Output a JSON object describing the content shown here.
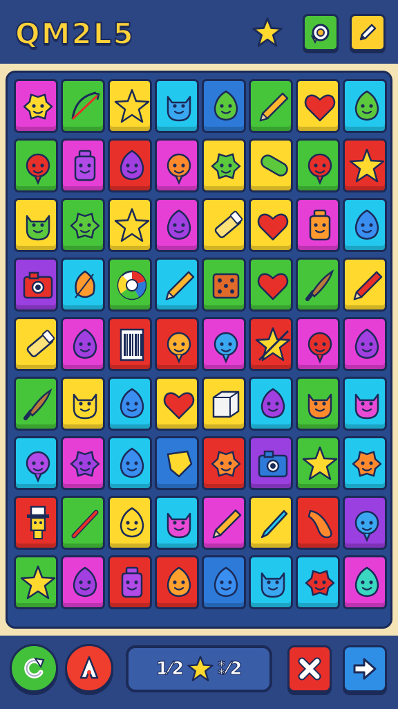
{
  "header": {
    "title": "QM2L5",
    "star_icon": "star-icon",
    "hint_button_icon": "target-icon",
    "edit_button_icon": "pencil-icon"
  },
  "board": {
    "rows": 9,
    "cols": 8,
    "colors": {
      "Y": "#ffd92e",
      "G": "#46c53a",
      "C": "#23c8ef",
      "M": "#e63fd6",
      "R": "#e8302a",
      "P": "#9a3fe0",
      "B": "#2d7ad8"
    },
    "tiles": [
      [
        {
          "bg": "M",
          "icon": "sun-face"
        },
        {
          "bg": "G",
          "icon": "bow-arrow"
        },
        {
          "bg": "Y",
          "icon": "star"
        },
        {
          "bg": "C",
          "icon": "blue-cat"
        },
        {
          "bg": "B",
          "icon": "green-blob"
        },
        {
          "bg": "G",
          "icon": "pencil"
        },
        {
          "bg": "Y",
          "icon": "heart"
        },
        {
          "bg": "C",
          "icon": "green-blob"
        }
      ],
      [
        {
          "bg": "G",
          "icon": "red-balloon"
        },
        {
          "bg": "M",
          "icon": "purple-jar"
        },
        {
          "bg": "R",
          "icon": "purple-blob"
        },
        {
          "bg": "M",
          "icon": "orange-ball"
        },
        {
          "bg": "Y",
          "icon": "green-spiky"
        },
        {
          "bg": "Y",
          "icon": "pickle"
        },
        {
          "bg": "G",
          "icon": "red-balloon"
        },
        {
          "bg": "R",
          "icon": "star"
        }
      ],
      [
        {
          "bg": "Y",
          "icon": "green-cat"
        },
        {
          "bg": "G",
          "icon": "green-spiky"
        },
        {
          "bg": "Y",
          "icon": "star"
        },
        {
          "bg": "M",
          "icon": "purple-blob"
        },
        {
          "bg": "Y",
          "icon": "crayon"
        },
        {
          "bg": "Y",
          "icon": "heart"
        },
        {
          "bg": "M",
          "icon": "orange-jar"
        },
        {
          "bg": "C",
          "icon": "blue-blob"
        }
      ],
      [
        {
          "bg": "P",
          "icon": "camera"
        },
        {
          "bg": "C",
          "icon": "orange-leaf"
        },
        {
          "bg": "G",
          "icon": "color-wheel"
        },
        {
          "bg": "C",
          "icon": "pencil"
        },
        {
          "bg": "G",
          "icon": "dice"
        },
        {
          "bg": "G",
          "icon": "heart"
        },
        {
          "bg": "G",
          "icon": "brush"
        },
        {
          "bg": "Y",
          "icon": "red-pencil"
        }
      ],
      [
        {
          "bg": "Y",
          "icon": "crayon"
        },
        {
          "bg": "M",
          "icon": "purple-blob"
        },
        {
          "bg": "R",
          "icon": "barcode"
        },
        {
          "bg": "R",
          "icon": "orange-balloon"
        },
        {
          "bg": "M",
          "icon": "blue-balloon"
        },
        {
          "bg": "R",
          "icon": "star-wand"
        },
        {
          "bg": "M",
          "icon": "red-balloon"
        },
        {
          "bg": "M",
          "icon": "purple-blob"
        }
      ],
      [
        {
          "bg": "G",
          "icon": "brush"
        },
        {
          "bg": "Y",
          "icon": "yellow-cat"
        },
        {
          "bg": "C",
          "icon": "blue-blob"
        },
        {
          "bg": "Y",
          "icon": "heart"
        },
        {
          "bg": "Y",
          "icon": "cube"
        },
        {
          "bg": "C",
          "icon": "purple-blob"
        },
        {
          "bg": "G",
          "icon": "orange-cat"
        },
        {
          "bg": "C",
          "icon": "pink-cat"
        }
      ],
      [
        {
          "bg": "C",
          "icon": "purple-balloon"
        },
        {
          "bg": "M",
          "icon": "purple-spiky"
        },
        {
          "bg": "C",
          "icon": "blue-blob"
        },
        {
          "bg": "B",
          "icon": "yellow-shape"
        },
        {
          "bg": "R",
          "icon": "orange-spiky"
        },
        {
          "bg": "P",
          "icon": "blue-camera"
        },
        {
          "bg": "G",
          "icon": "star"
        },
        {
          "bg": "C",
          "icon": "orange-spiky"
        }
      ],
      [
        {
          "bg": "R",
          "icon": "hat-man"
        },
        {
          "bg": "G",
          "icon": "red-stick"
        },
        {
          "bg": "Y",
          "icon": "yellow-blob"
        },
        {
          "bg": "C",
          "icon": "pink-cat"
        },
        {
          "bg": "M",
          "icon": "pencil"
        },
        {
          "bg": "Y",
          "icon": "blue-pen"
        },
        {
          "bg": "R",
          "icon": "orange-tube"
        },
        {
          "bg": "P",
          "icon": "blue-balloon"
        }
      ],
      [
        {
          "bg": "G",
          "icon": "star"
        },
        {
          "bg": "M",
          "icon": "purple-blob"
        },
        {
          "bg": "R",
          "icon": "purple-jar"
        },
        {
          "bg": "R",
          "icon": "orange-blob"
        },
        {
          "bg": "B",
          "icon": "blue-blob"
        },
        {
          "bg": "C",
          "icon": "blue-cat"
        },
        {
          "bg": "C",
          "icon": "red-spiky"
        },
        {
          "bg": "M",
          "icon": "teal-blob"
        }
      ]
    ]
  },
  "footer": {
    "restart_icon": "restart-icon",
    "hint_icon": "hint-icon",
    "score_left": "1⁄2",
    "score_right": "⁑⁄2",
    "score_star_icon": "star-icon",
    "close_icon": "close-icon",
    "next_icon": "arrow-right-icon"
  }
}
